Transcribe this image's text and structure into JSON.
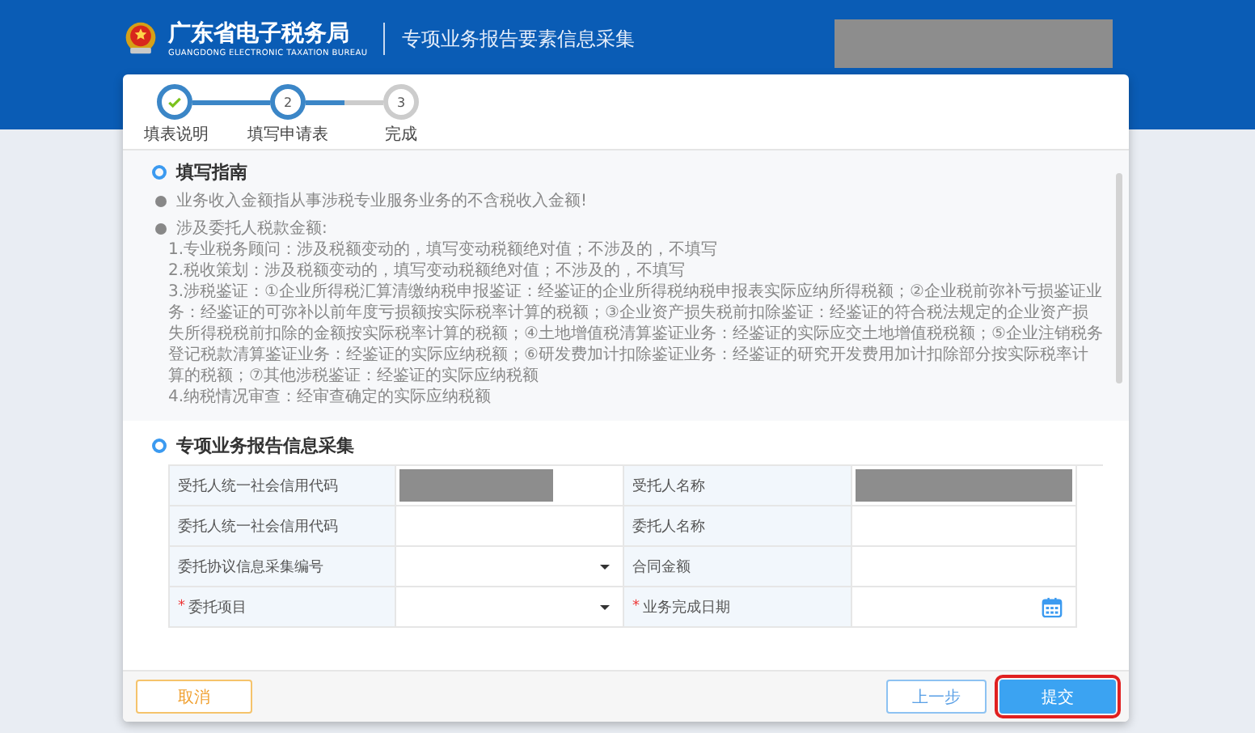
{
  "header": {
    "title": "广东省电子税务局",
    "subtitle": "GUANGDONG ELECTRONIC TAXATION BUREAU",
    "page_title": "专项业务报告要素信息采集"
  },
  "steps": [
    {
      "label": "填表说明",
      "completed": true,
      "current": false
    },
    {
      "number": "2",
      "label": "填写申请表",
      "completed": false,
      "current": true
    },
    {
      "number": "3",
      "label": "完成",
      "completed": false,
      "current": false
    }
  ],
  "guide": {
    "title": "填写指南",
    "items": [
      {
        "text": "业务收入金额指从事涉税专业服务业务的不含税收入金额!"
      },
      {
        "text": "涉及委托人税款金额:",
        "lines": [
          "1.专业税务顾问：涉及税额变动的，填写变动税额绝对值；不涉及的，不填写",
          "2.税收策划：涉及税额变动的，填写变动税额绝对值；不涉及的，不填写",
          "3.涉税鉴证：①企业所得税汇算清缴纳税申报鉴证：经鉴证的企业所得税纳税申报表实际应纳所得税额；②企业税前弥补亏损鉴证业务：经鉴证的可弥补以前年度亏损额按实际税率计算的税额；③企业资产损失税前扣除鉴证：经鉴证的符合税法规定的企业资产损失所得税税前扣除的金额按实际税率计算的税额；④土地增值税清算鉴证业务：经鉴证的实际应交土地增值税税额；⑤企业注销税务登记税款清算鉴证业务：经鉴证的实际应纳税额；⑥研发费加计扣除鉴证业务：经鉴证的研究开发费用加计扣除部分按实际税率计算的税额；⑦其他涉税鉴证：经鉴证的实际应纳税额",
          "4.纳税情况审查：经审查确定的实际应纳税额"
        ]
      }
    ]
  },
  "form": {
    "title": "专项业务报告信息采集",
    "rows": [
      [
        {
          "label": "受托人统一社会信用代码",
          "kind": "redacted"
        },
        {
          "label": "受托人名称",
          "kind": "redacted"
        }
      ],
      [
        {
          "label": "委托人统一社会信用代码",
          "kind": "text"
        },
        {
          "label": "委托人名称",
          "kind": "text"
        }
      ],
      [
        {
          "label": "委托协议信息采集编号",
          "kind": "select"
        },
        {
          "label": "合同金额",
          "kind": "text"
        }
      ],
      [
        {
          "required_mark": "*",
          "label": "委托项目",
          "kind": "select"
        },
        {
          "required_mark": "*",
          "label": "业务完成日期",
          "kind": "date"
        }
      ]
    ]
  },
  "buttons": [
    {
      "label": "取消",
      "kind": "cancel",
      "highlighted": false
    },
    {
      "label": "上一步",
      "kind": "prev",
      "highlighted": false
    },
    {
      "label": "提交",
      "kind": "submit",
      "highlighted": true
    }
  ]
}
